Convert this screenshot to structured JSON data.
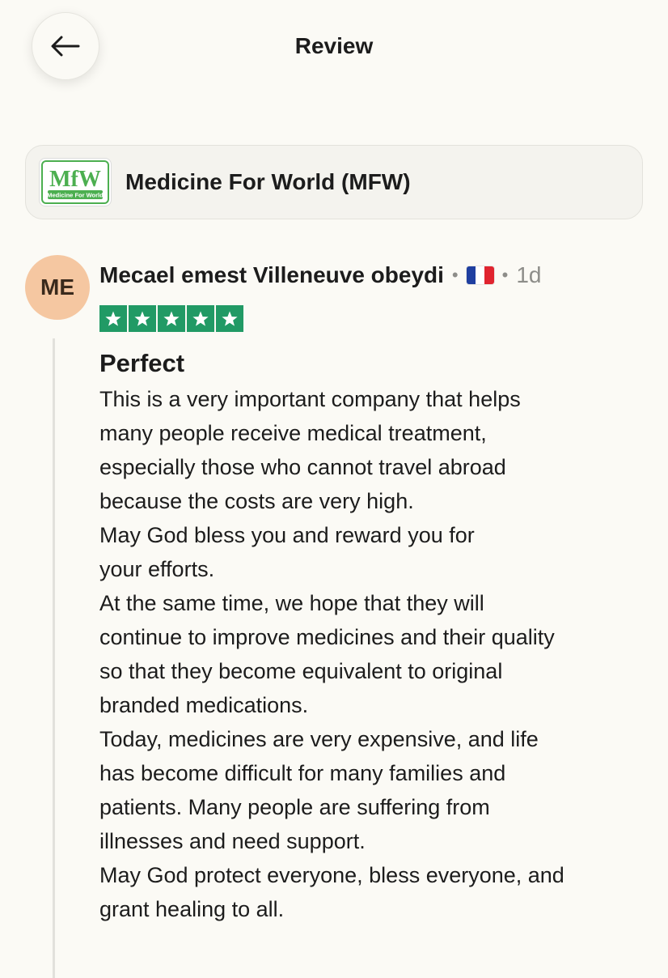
{
  "header": {
    "title": "Review",
    "back_icon": "arrow-left-icon"
  },
  "company": {
    "name": "Medicine For World (MFW)",
    "logo_text": "MfW",
    "logo_subtext": "Medicine For World",
    "logo_color": "#4caf50"
  },
  "review": {
    "avatar_initials": "ME",
    "avatar_color": "#f5c7a1",
    "reviewer_name": "Mecael emest Villeneuve obeydi",
    "country_flag": "france-flag-icon",
    "age": "1d",
    "rating": 5,
    "max_rating": 5,
    "star_color": "#219a65",
    "title": "Perfect",
    "body_lines": [
      "This is a very important company that helps",
      "many people receive medical treatment,",
      "especially those who cannot travel abroad",
      "because the costs are very high.",
      "May God bless you and reward you for",
      "your efforts.",
      "At the same time, we hope that they will",
      "continue to improve medicines and their quality",
      "so that they become equivalent to original",
      "branded medications.",
      "Today, medicines are very expensive, and life",
      "has become difficult for many families and",
      "patients. Many people are suffering from",
      "illnesses and need support.",
      "May God protect everyone, bless everyone, and",
      "grant healing to all."
    ]
  }
}
